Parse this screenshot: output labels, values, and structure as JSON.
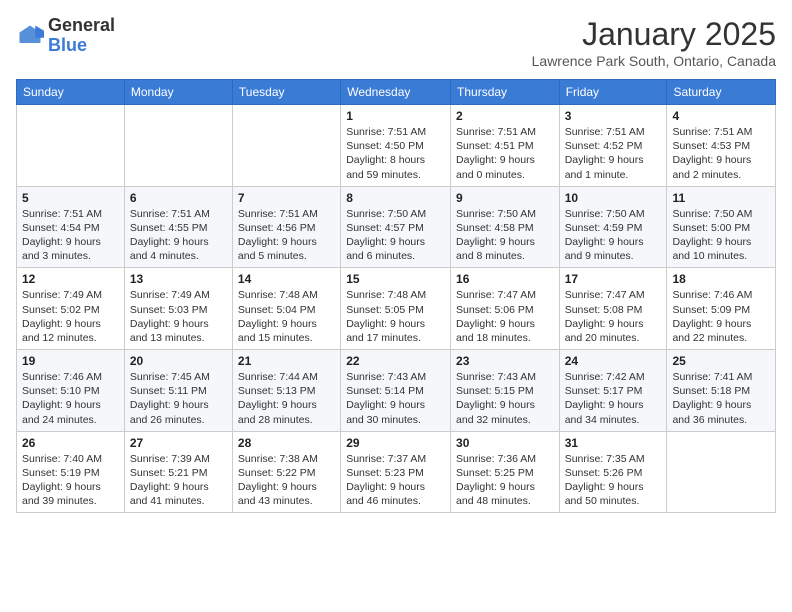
{
  "header": {
    "logo_general": "General",
    "logo_blue": "Blue",
    "month": "January 2025",
    "location": "Lawrence Park South, Ontario, Canada"
  },
  "days_of_week": [
    "Sunday",
    "Monday",
    "Tuesday",
    "Wednesday",
    "Thursday",
    "Friday",
    "Saturday"
  ],
  "weeks": [
    [
      {
        "day": "",
        "info": ""
      },
      {
        "day": "",
        "info": ""
      },
      {
        "day": "",
        "info": ""
      },
      {
        "day": "1",
        "info": "Sunrise: 7:51 AM\nSunset: 4:50 PM\nDaylight: 8 hours and 59 minutes."
      },
      {
        "day": "2",
        "info": "Sunrise: 7:51 AM\nSunset: 4:51 PM\nDaylight: 9 hours and 0 minutes."
      },
      {
        "day": "3",
        "info": "Sunrise: 7:51 AM\nSunset: 4:52 PM\nDaylight: 9 hours and 1 minute."
      },
      {
        "day": "4",
        "info": "Sunrise: 7:51 AM\nSunset: 4:53 PM\nDaylight: 9 hours and 2 minutes."
      }
    ],
    [
      {
        "day": "5",
        "info": "Sunrise: 7:51 AM\nSunset: 4:54 PM\nDaylight: 9 hours and 3 minutes."
      },
      {
        "day": "6",
        "info": "Sunrise: 7:51 AM\nSunset: 4:55 PM\nDaylight: 9 hours and 4 minutes."
      },
      {
        "day": "7",
        "info": "Sunrise: 7:51 AM\nSunset: 4:56 PM\nDaylight: 9 hours and 5 minutes."
      },
      {
        "day": "8",
        "info": "Sunrise: 7:50 AM\nSunset: 4:57 PM\nDaylight: 9 hours and 6 minutes."
      },
      {
        "day": "9",
        "info": "Sunrise: 7:50 AM\nSunset: 4:58 PM\nDaylight: 9 hours and 8 minutes."
      },
      {
        "day": "10",
        "info": "Sunrise: 7:50 AM\nSunset: 4:59 PM\nDaylight: 9 hours and 9 minutes."
      },
      {
        "day": "11",
        "info": "Sunrise: 7:50 AM\nSunset: 5:00 PM\nDaylight: 9 hours and 10 minutes."
      }
    ],
    [
      {
        "day": "12",
        "info": "Sunrise: 7:49 AM\nSunset: 5:02 PM\nDaylight: 9 hours and 12 minutes."
      },
      {
        "day": "13",
        "info": "Sunrise: 7:49 AM\nSunset: 5:03 PM\nDaylight: 9 hours and 13 minutes."
      },
      {
        "day": "14",
        "info": "Sunrise: 7:48 AM\nSunset: 5:04 PM\nDaylight: 9 hours and 15 minutes."
      },
      {
        "day": "15",
        "info": "Sunrise: 7:48 AM\nSunset: 5:05 PM\nDaylight: 9 hours and 17 minutes."
      },
      {
        "day": "16",
        "info": "Sunrise: 7:47 AM\nSunset: 5:06 PM\nDaylight: 9 hours and 18 minutes."
      },
      {
        "day": "17",
        "info": "Sunrise: 7:47 AM\nSunset: 5:08 PM\nDaylight: 9 hours and 20 minutes."
      },
      {
        "day": "18",
        "info": "Sunrise: 7:46 AM\nSunset: 5:09 PM\nDaylight: 9 hours and 22 minutes."
      }
    ],
    [
      {
        "day": "19",
        "info": "Sunrise: 7:46 AM\nSunset: 5:10 PM\nDaylight: 9 hours and 24 minutes."
      },
      {
        "day": "20",
        "info": "Sunrise: 7:45 AM\nSunset: 5:11 PM\nDaylight: 9 hours and 26 minutes."
      },
      {
        "day": "21",
        "info": "Sunrise: 7:44 AM\nSunset: 5:13 PM\nDaylight: 9 hours and 28 minutes."
      },
      {
        "day": "22",
        "info": "Sunrise: 7:43 AM\nSunset: 5:14 PM\nDaylight: 9 hours and 30 minutes."
      },
      {
        "day": "23",
        "info": "Sunrise: 7:43 AM\nSunset: 5:15 PM\nDaylight: 9 hours and 32 minutes."
      },
      {
        "day": "24",
        "info": "Sunrise: 7:42 AM\nSunset: 5:17 PM\nDaylight: 9 hours and 34 minutes."
      },
      {
        "day": "25",
        "info": "Sunrise: 7:41 AM\nSunset: 5:18 PM\nDaylight: 9 hours and 36 minutes."
      }
    ],
    [
      {
        "day": "26",
        "info": "Sunrise: 7:40 AM\nSunset: 5:19 PM\nDaylight: 9 hours and 39 minutes."
      },
      {
        "day": "27",
        "info": "Sunrise: 7:39 AM\nSunset: 5:21 PM\nDaylight: 9 hours and 41 minutes."
      },
      {
        "day": "28",
        "info": "Sunrise: 7:38 AM\nSunset: 5:22 PM\nDaylight: 9 hours and 43 minutes."
      },
      {
        "day": "29",
        "info": "Sunrise: 7:37 AM\nSunset: 5:23 PM\nDaylight: 9 hours and 46 minutes."
      },
      {
        "day": "30",
        "info": "Sunrise: 7:36 AM\nSunset: 5:25 PM\nDaylight: 9 hours and 48 minutes."
      },
      {
        "day": "31",
        "info": "Sunrise: 7:35 AM\nSunset: 5:26 PM\nDaylight: 9 hours and 50 minutes."
      },
      {
        "day": "",
        "info": ""
      }
    ]
  ]
}
